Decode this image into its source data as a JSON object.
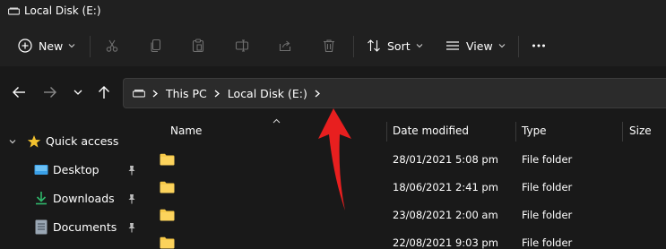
{
  "window": {
    "title": "Local Disk (E:)"
  },
  "toolbar": {
    "new_label": "New",
    "sort_label": "Sort",
    "view_label": "View"
  },
  "address": {
    "crumbs": [
      "This PC",
      "Local Disk (E:)"
    ]
  },
  "sidebar": {
    "items": [
      {
        "label": "Quick access",
        "icon": "star-icon",
        "color": "#f2c12e"
      },
      {
        "label": "Desktop",
        "icon": "desktop-folder-icon",
        "color": "#3aa0e8"
      },
      {
        "label": "Downloads",
        "icon": "download-icon",
        "color": "#2fb86b"
      },
      {
        "label": "Documents",
        "icon": "document-icon",
        "color": "#9aa7b4"
      }
    ]
  },
  "columns": {
    "name": "Name",
    "date": "Date modified",
    "type": "Type",
    "size": "Size"
  },
  "rows": [
    {
      "date": "28/01/2021 5:08 pm",
      "type": "File folder"
    },
    {
      "date": "18/06/2021 2:41 pm",
      "type": "File folder"
    },
    {
      "date": "23/08/2021 2:00 am",
      "type": "File folder"
    },
    {
      "date": "22/08/2021 9:03 pm",
      "type": "File folder"
    }
  ],
  "colors": {
    "folder": "#f7c948",
    "accent_arrow": "#e81f1f"
  }
}
